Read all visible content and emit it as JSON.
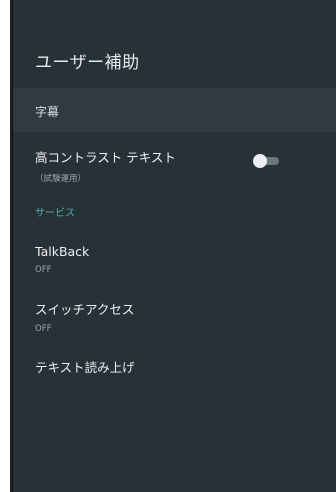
{
  "header": {
    "title": "ユーザー補助"
  },
  "section": {
    "label": "字幕"
  },
  "items": [
    {
      "title": "高コントラスト テキスト",
      "subtitle": "（試験運用）",
      "toggle": "off"
    },
    {
      "category": "サービス"
    },
    {
      "title": "TalkBack",
      "subtitle": "OFF"
    },
    {
      "title": "スイッチアクセス",
      "subtitle": "OFF"
    },
    {
      "title": "テキスト読み上げ"
    }
  ]
}
